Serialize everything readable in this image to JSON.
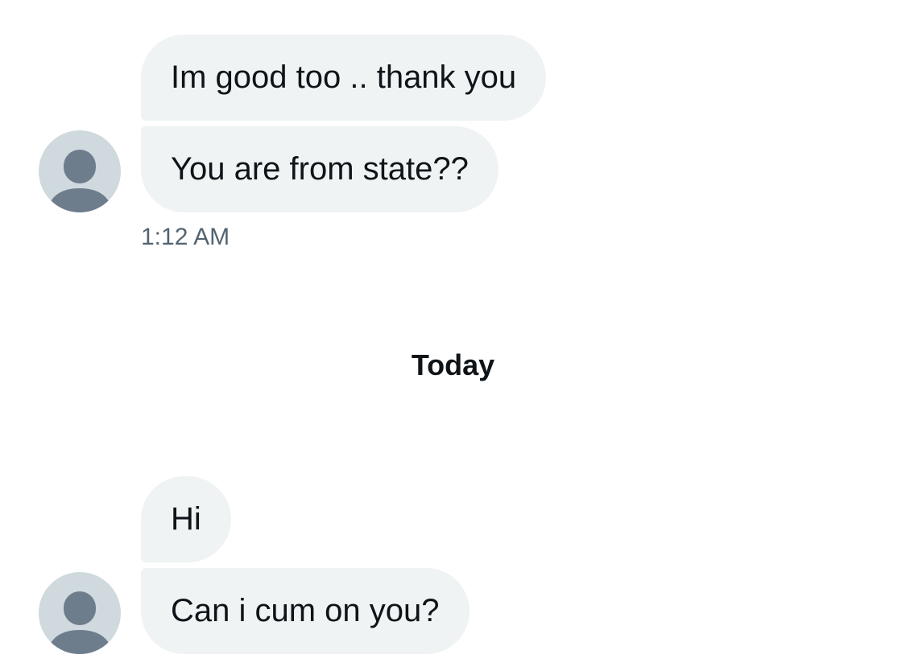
{
  "colors": {
    "bubble_bg": "#eff3f4",
    "avatar_bg": "#cfd9de",
    "avatar_figure": "#6e7d8c",
    "timestamp_text": "#536471",
    "primary_text": "#0f1419"
  },
  "avatar_icon": "default-profile-avatar-icon",
  "groups": [
    {
      "messages": [
        {
          "text": "Im good too .. thank you"
        },
        {
          "text": "You are from state??"
        }
      ],
      "timestamp": "1:12 AM"
    },
    {
      "messages": [
        {
          "text": "Hi"
        },
        {
          "text": "Can i cum on you?"
        }
      ]
    }
  ],
  "day_separator": "Today"
}
